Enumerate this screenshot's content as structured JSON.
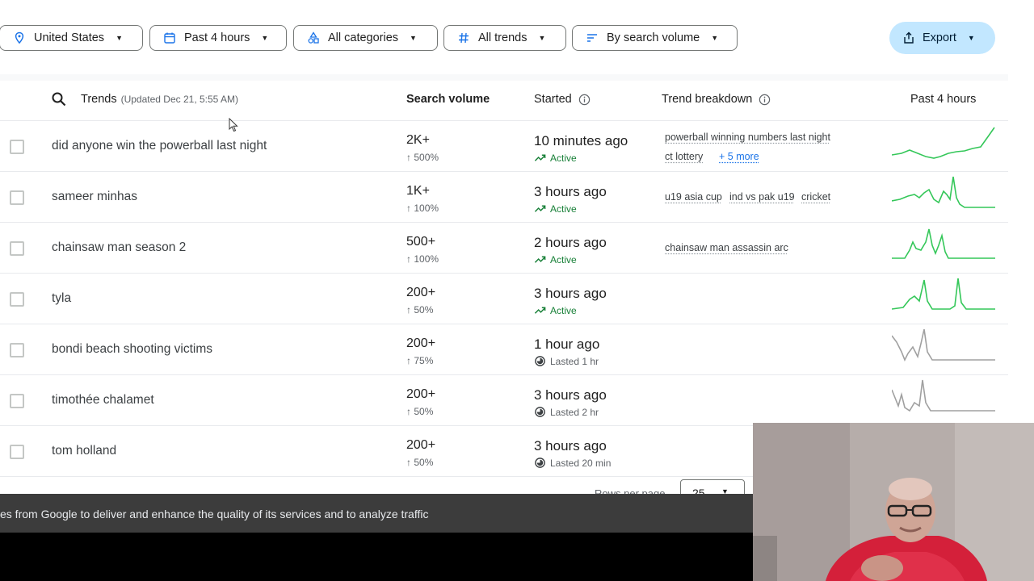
{
  "filters": {
    "location": "United States",
    "time": "Past 4 hours",
    "category": "All categories",
    "trend_type": "All trends",
    "sort": "By search volume",
    "export": "Export"
  },
  "table": {
    "header": {
      "trends": "Trends",
      "updated": "(Updated Dec 21, 5:55 AM)",
      "search_volume": "Search volume",
      "started": "Started",
      "breakdown": "Trend breakdown",
      "chart_period": "Past 4 hours"
    },
    "rows": [
      {
        "term": "did anyone win the powerball last night",
        "volume": "2K+",
        "change": "500%",
        "started": "10 minutes ago",
        "status": "Active",
        "breakdown": [
          "powerball winning numbers last night",
          "ct lottery"
        ],
        "more": "+ 5 more",
        "active": true
      },
      {
        "term": "sameer minhas",
        "volume": "1K+",
        "change": "100%",
        "started": "3 hours ago",
        "status": "Active",
        "breakdown": [
          "u19 asia cup",
          "ind vs pak u19",
          "cricket"
        ],
        "active": true
      },
      {
        "term": "chainsaw man season 2",
        "volume": "500+",
        "change": "100%",
        "started": "2 hours ago",
        "status": "Active",
        "breakdown": [
          "chainsaw man assassin arc"
        ],
        "active": true
      },
      {
        "term": "tyla",
        "volume": "200+",
        "change": "50%",
        "started": "3 hours ago",
        "status": "Active",
        "breakdown": [],
        "active": true
      },
      {
        "term": "bondi beach shooting victims",
        "volume": "200+",
        "change": "75%",
        "started": "1 hour ago",
        "status": "Lasted 1 hr",
        "breakdown": [],
        "active": false
      },
      {
        "term": "timothée chalamet",
        "volume": "200+",
        "change": "50%",
        "started": "3 hours ago",
        "status": "Lasted 2 hr",
        "breakdown": [],
        "active": false
      },
      {
        "term": "tom holland",
        "volume": "200+",
        "change": "50%",
        "started": "3 hours ago",
        "status": "Lasted 20 min",
        "breakdown": [],
        "active": false
      }
    ]
  },
  "pagination": {
    "rows_per_page_label": "Rows per page",
    "rows_per_page_value": "25"
  },
  "cookie_banner": {
    "text": "es from Google to deliver and enhance the quality of its services and to analyze traffic"
  },
  "colors": {
    "active_green": "#188038",
    "spark_active": "#34c759",
    "spark_ended": "#a0a0a0",
    "export_bg": "#c2e7ff"
  }
}
